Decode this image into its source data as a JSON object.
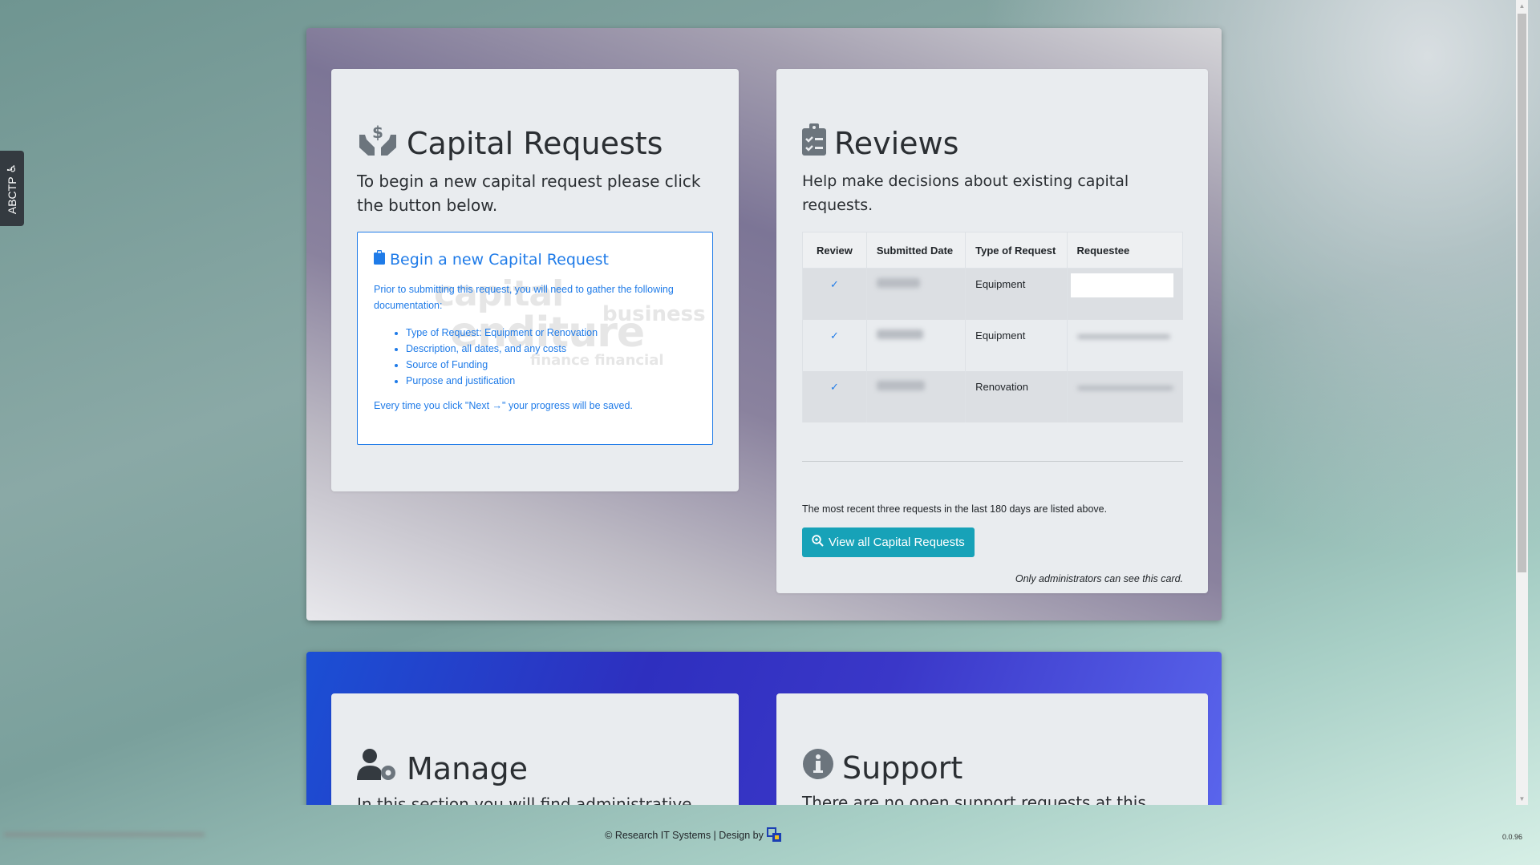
{
  "side_tab": {
    "label": "ABCTP"
  },
  "capital": {
    "title": "Capital Requests",
    "lead": "To begin a new capital request please click the button below.",
    "begin": {
      "title": "Begin a new Capital Request",
      "text": "Prior to submitting this request, you will need to gather the following documentation:",
      "items": [
        "Type of Request: Equipment or Renovation",
        "Description, all dates, and any costs",
        "Source of Funding",
        "Purpose and justification"
      ],
      "footer": "Every time you click \"Next →\" your progress will be saved.",
      "watermark": {
        "line1": "capital",
        "line2": "enditure",
        "line3": "finance   financial",
        "business": "business"
      }
    }
  },
  "reviews": {
    "title": "Reviews",
    "lead": "Help make decisions about existing capital requests.",
    "columns": [
      "Review",
      "Submitted Date",
      "Type of Request",
      "Requestee"
    ],
    "rows": [
      {
        "type": "Equipment"
      },
      {
        "type": "Equipment"
      },
      {
        "type": "Renovation"
      }
    ],
    "note": "The most recent three requests in the last 180 days are listed above.",
    "view_all_label": "View all Capital Requests",
    "admin_note": "Only administrators can see this card."
  },
  "manage": {
    "title": "Manage",
    "lead": "In this section you will find administrative tools to"
  },
  "support": {
    "title": "Support",
    "lead": "There are no open support requests at this time."
  },
  "footer": {
    "copyright": "© Research IT Systems | Design by",
    "version": "0.0.96"
  },
  "colors": {
    "link": "#1f7be8",
    "button": "#17a2b8",
    "card_bg": "#e9ecef"
  }
}
